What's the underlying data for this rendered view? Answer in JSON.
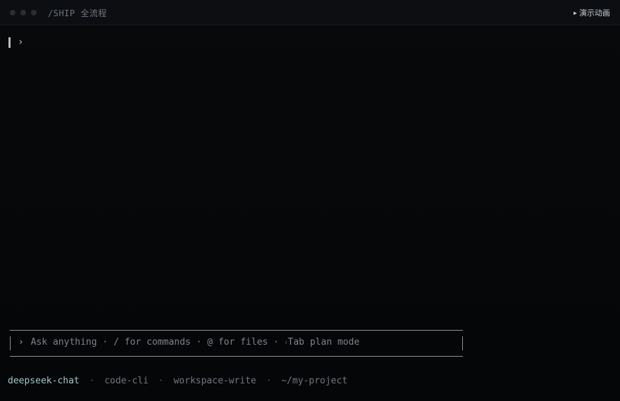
{
  "window": {
    "title": "/SHIP 全流程",
    "demo_button": {
      "icon": "play-icon",
      "icon_glyph": "▶",
      "label": "演示动画"
    }
  },
  "terminal": {
    "prompt_symbol": "›"
  },
  "input": {
    "prompt_symbol": "›",
    "placeholder_parts": {
      "ask": "Ask anything",
      "commands": "/ for commands",
      "files": "@ for files",
      "shift_glyph": "⇧",
      "plan": "Tab plan mode"
    },
    "separator": "·"
  },
  "status": {
    "model": "deepseek-chat",
    "agent": "code-cli",
    "permissions": "workspace-write",
    "path": "~/my-project",
    "separator": "·"
  },
  "colors": {
    "background": "#050608",
    "titlebar": "#0c0e11",
    "model_accent": "#9fc7c9",
    "text_dim": "#7c838b"
  }
}
